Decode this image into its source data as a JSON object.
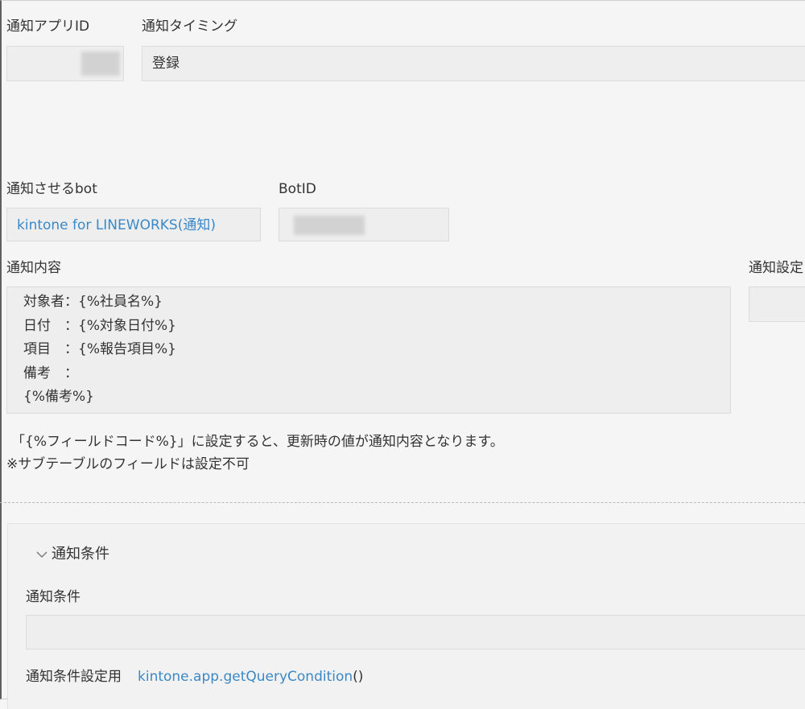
{
  "notify_app_id": {
    "label": "通知アプリID"
  },
  "notify_timing": {
    "label": "通知タイミング",
    "value": "登録"
  },
  "notify_bot": {
    "label": "通知させるbot",
    "value": "kintone for LINEWORKS(通知)"
  },
  "bot_id": {
    "label": "BotID"
  },
  "notify_content": {
    "label": "通知内容",
    "value": "対象者：{%社員名%}\n日付　：{%対象日付%}\n項目　：{%報告項目%}\n備考　：\n{%備考%}"
  },
  "notify_settings": {
    "label": "通知設定"
  },
  "hint": {
    "line1": "「{%フィールドコード%}」に設定すると、更新時の値が通知内容となります。",
    "line2": "※サブテーブルのフィールドは設定不可"
  },
  "conditions": {
    "section_title": "通知条件",
    "field_label": "通知条件",
    "value": "",
    "helper_label": "通知条件設定用",
    "helper_link": "kintone.app.getQueryCondition",
    "helper_suffix": "()"
  },
  "icons": {
    "section_toggle": "chevron-down-icon"
  },
  "colors": {
    "background": "#f5f5f5",
    "field_bg": "#eeeeee",
    "link": "#3b88c6",
    "text": "#333333"
  }
}
